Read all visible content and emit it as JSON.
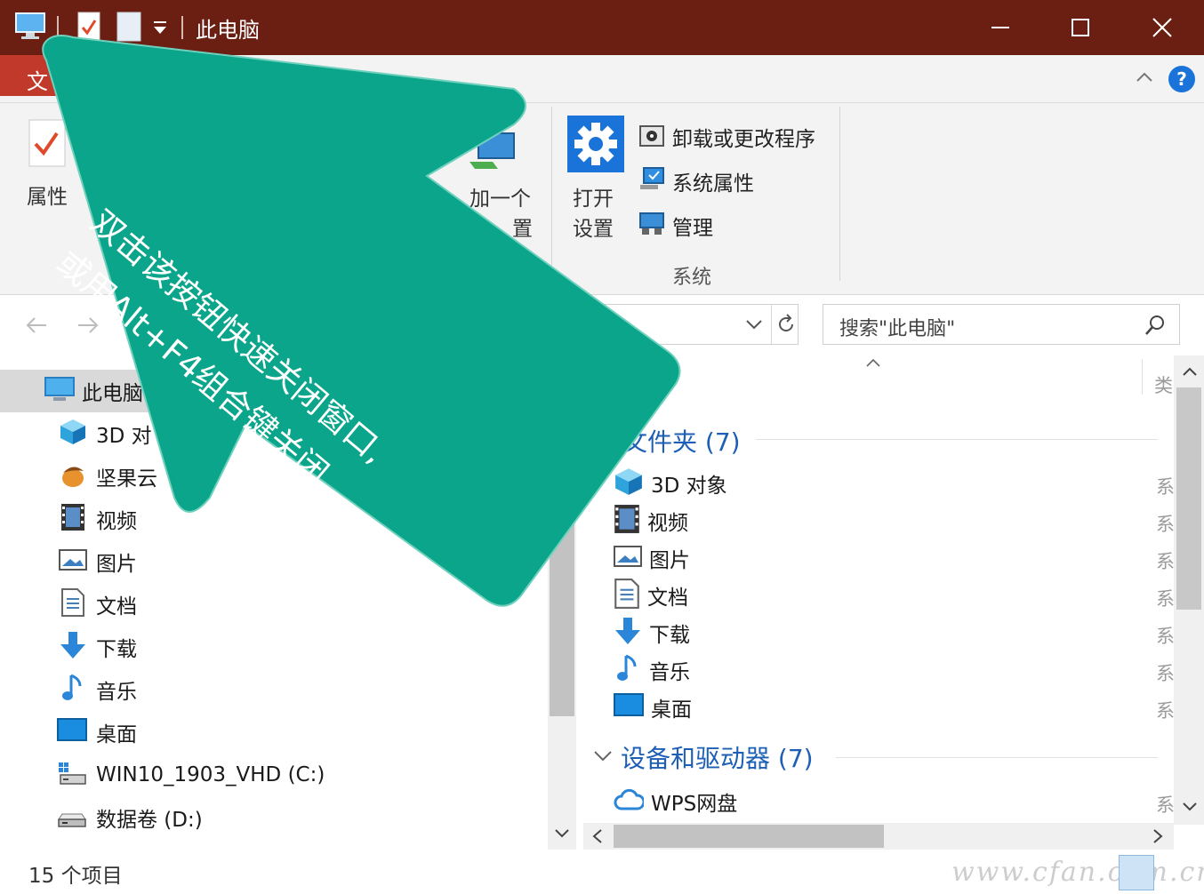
{
  "titlebar": {
    "title": "此电脑",
    "minimize_label": "—",
    "maximize_label": "□",
    "close_label": "✕"
  },
  "tabs": {
    "file_label": "文"
  },
  "ribbon": {
    "properties_label": "属性",
    "add_location_label_1": "加一个",
    "add_location_label_2": "置",
    "open_settings_label_1": "打开",
    "open_settings_label_2": "设置",
    "uninstall_label": "卸载或更改程序",
    "system_props_label": "系统属性",
    "manage_label": "管理",
    "system_group_label": "系统"
  },
  "nav": {
    "search_placeholder": "搜索\"此电脑\"",
    "refresh_icon": "refresh-icon"
  },
  "tree": {
    "items": [
      {
        "label": "此电脑",
        "icon": "computer-icon"
      },
      {
        "label": "3D 对",
        "icon": "cube-icon"
      },
      {
        "label": "坚果云",
        "icon": "nut-icon"
      },
      {
        "label": "视频",
        "icon": "video-icon"
      },
      {
        "label": "图片",
        "icon": "picture-icon"
      },
      {
        "label": "文档",
        "icon": "document-icon"
      },
      {
        "label": "下载",
        "icon": "download-icon"
      },
      {
        "label": "音乐",
        "icon": "music-icon"
      },
      {
        "label": "桌面",
        "icon": "desktop-icon"
      },
      {
        "label": "WIN10_1903_VHD (C:)",
        "icon": "windows-drive-icon"
      },
      {
        "label": "数据卷 (D:)",
        "icon": "drive-icon"
      }
    ]
  },
  "content": {
    "type_header": "类",
    "folders_group": "文件夹 (7)",
    "folders": [
      {
        "label": "3D 对象",
        "type": "系"
      },
      {
        "label": "视频",
        "type": "系"
      },
      {
        "label": "图片",
        "type": "系"
      },
      {
        "label": "文档",
        "type": "系"
      },
      {
        "label": "下载",
        "type": "系"
      },
      {
        "label": "音乐",
        "type": "系"
      },
      {
        "label": "桌面",
        "type": "系"
      }
    ],
    "devices_group": "设备和驱动器 (7)",
    "devices": [
      {
        "label": "WPS网盘",
        "type": "系"
      }
    ]
  },
  "status": {
    "count": "15 个项目",
    "watermark": "www.cfan.com.cn"
  },
  "annotation": {
    "line1": "双击该按钮快速关闭窗口,",
    "line2": "或用Alt+F4组合键关闭"
  },
  "colors": {
    "titlebar": "#6a1f12",
    "file_tab": "#c0392b",
    "arrow": "#0aa58a",
    "group_heading": "#1c5fb5"
  }
}
